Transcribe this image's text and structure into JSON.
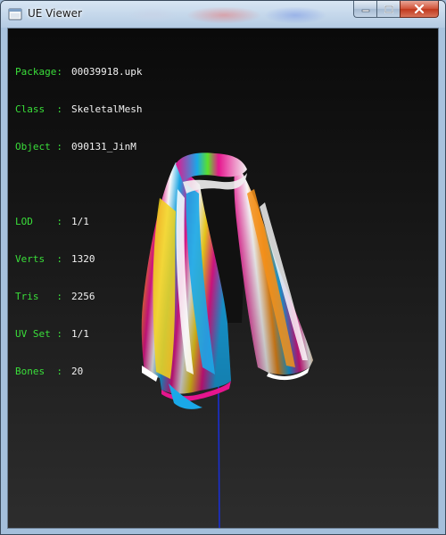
{
  "window": {
    "title": "UE Viewer",
    "icons": {
      "app": "ue-viewer-app-icon",
      "minimize": "minimize-icon",
      "maximize": "maximize-icon",
      "close": "close-icon"
    }
  },
  "info": {
    "package_label": "Package:",
    "package_value": "00039918.upk",
    "class_label": "Class  :",
    "class_value": "SkeletalMesh",
    "object_label": "Object :",
    "object_value": "090131_JinM",
    "lod_label": "LOD    :",
    "lod_value": "1/1",
    "verts_label": "Verts  :",
    "verts_value": "1320",
    "tris_label": "Tris   :",
    "tris_value": "2256",
    "uvset_label": "UV Set :",
    "uvset_value": "1/1",
    "bones_label": "Bones  :",
    "bones_value": "20"
  },
  "colors": {
    "label_green": "#3adf3a",
    "value_white": "#f2f2f2",
    "axis_blue": "#1a2fd0",
    "scarf_magenta": "#e6158e",
    "scarf_cyan": "#1aa8e8",
    "scarf_yellow": "#f5d41a",
    "scarf_orange": "#f5901a"
  }
}
